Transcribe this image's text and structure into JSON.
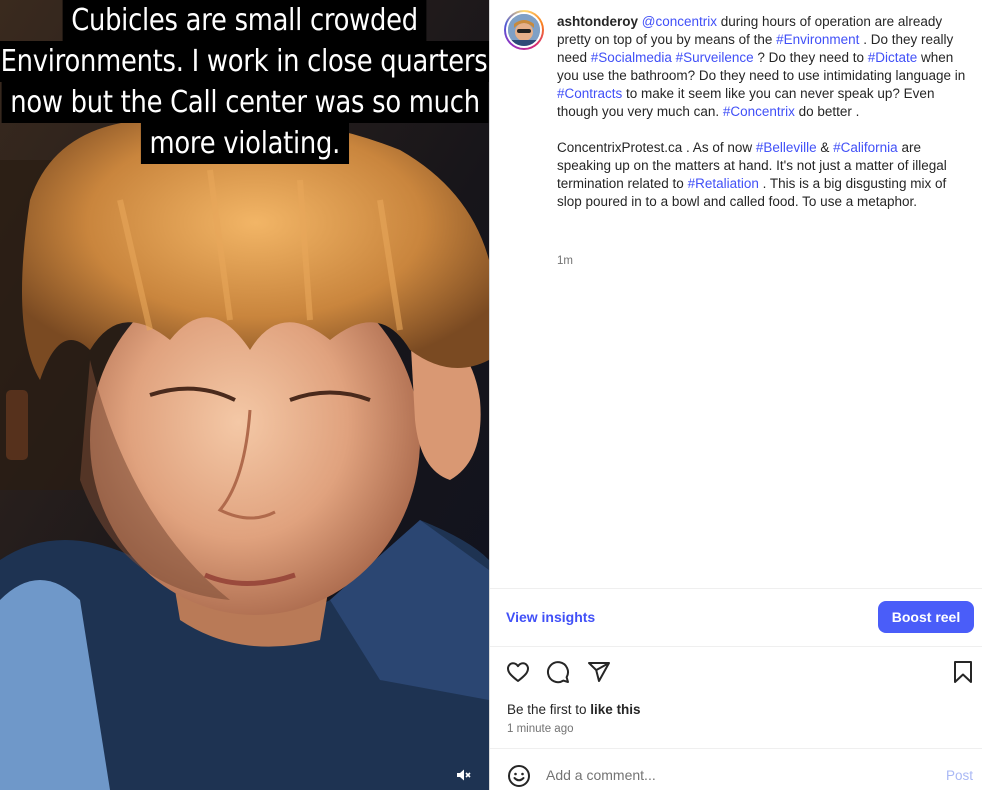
{
  "media": {
    "caption_lines": [
      "Cubicles are small crowded",
      "Environments. I work in close quarters",
      "now but the Call center was so much",
      "more violating."
    ],
    "mute_icon": "speaker-muted-icon"
  },
  "post": {
    "username": "ashtonderoy",
    "caption": [
      [
        {
          "text": "@concentrix",
          "tag": true
        },
        {
          "text": " during hours of operation are already pretty on top of you by means of the ",
          "tag": false
        },
        {
          "text": "#Environment",
          "tag": true
        },
        {
          "text": " . Do they really need ",
          "tag": false
        },
        {
          "text": "#Socialmedia",
          "tag": true
        },
        {
          "text": " ",
          "tag": false
        },
        {
          "text": "#Surveilence",
          "tag": true
        },
        {
          "text": " ? Do they need to ",
          "tag": false
        },
        {
          "text": "#Dictate",
          "tag": true
        },
        {
          "text": " when you use the bathroom? Do they need to use intimidating language in ",
          "tag": false
        },
        {
          "text": "#Contracts",
          "tag": true
        },
        {
          "text": " to make it seem like you can never speak up? Even though you very much can. ",
          "tag": false
        },
        {
          "text": "#Concentrix",
          "tag": true
        },
        {
          "text": " do better .",
          "tag": false
        }
      ],
      [
        {
          "text": "ConcentrixProtest.ca . As of now ",
          "tag": false
        },
        {
          "text": "#Belleville",
          "tag": true
        },
        {
          "text": " & ",
          "tag": false
        },
        {
          "text": "#California",
          "tag": true
        },
        {
          "text": " are speaking up on the matters at hand. It's not just a matter of illegal termination related to ",
          "tag": false
        },
        {
          "text": "#Retaliation",
          "tag": true
        },
        {
          "text": " . This is a big disgusting mix of slop poured in to a bowl and called food. To use a metaphor.",
          "tag": false
        }
      ]
    ],
    "relative_time": "1m"
  },
  "insights": {
    "view_label": "View insights",
    "boost_label": "Boost reel"
  },
  "actions": {
    "like_icon": "heart-icon",
    "comment_icon": "comment-icon",
    "share_icon": "share-icon",
    "save_icon": "bookmark-icon",
    "likes_prefix": "Be the first to ",
    "likes_bold": "like this",
    "timestamp": "1 minute ago"
  },
  "comment": {
    "emoji_icon": "emoji-icon",
    "placeholder": "Add a comment...",
    "post_label": "Post"
  },
  "colors": {
    "link": "#4150f7",
    "boost": "#4a5df9",
    "post_disabled": "#a9b8f5"
  }
}
